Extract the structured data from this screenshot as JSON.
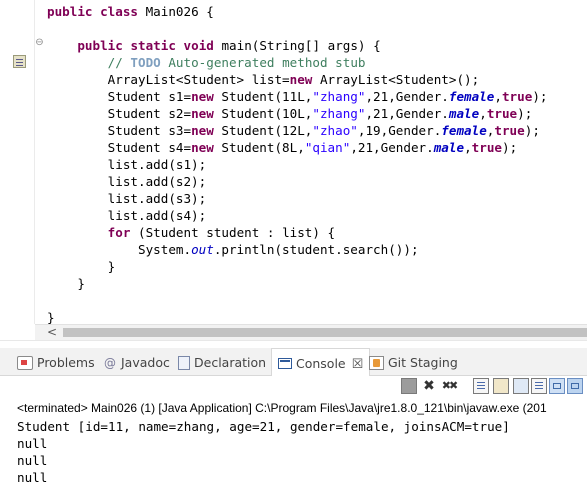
{
  "editor": {
    "lines": [
      {
        "parts": [
          {
            "t": "public",
            "c": "kw"
          },
          {
            "t": " "
          },
          {
            "t": "class",
            "c": "kw"
          },
          {
            "t": " Main026 {"
          }
        ]
      },
      {
        "parts": []
      },
      {
        "parts": [
          {
            "t": "    "
          },
          {
            "t": "public",
            "c": "kw"
          },
          {
            "t": " "
          },
          {
            "t": "static",
            "c": "kw"
          },
          {
            "t": " "
          },
          {
            "t": "void",
            "c": "kw"
          },
          {
            "t": " main(String[] args) {"
          }
        ]
      },
      {
        "parts": [
          {
            "t": "        "
          },
          {
            "t": "// ",
            "c": "cm"
          },
          {
            "t": "TODO",
            "c": "tg"
          },
          {
            "t": " Auto-generated method stub",
            "c": "cm"
          }
        ]
      },
      {
        "parts": [
          {
            "t": "        ArrayList<Student> list="
          },
          {
            "t": "new",
            "c": "kw"
          },
          {
            "t": " ArrayList<Student>();"
          }
        ]
      },
      {
        "parts": [
          {
            "t": "        Student s1="
          },
          {
            "t": "new",
            "c": "kw"
          },
          {
            "t": " Student(11L,"
          },
          {
            "t": "\"zhang\"",
            "c": "st"
          },
          {
            "t": ",21,Gender."
          },
          {
            "t": "female",
            "c": "fi"
          },
          {
            "t": ","
          },
          {
            "t": "true",
            "c": "kw"
          },
          {
            "t": ");"
          }
        ]
      },
      {
        "parts": [
          {
            "t": "        Student s2="
          },
          {
            "t": "new",
            "c": "kw"
          },
          {
            "t": " Student(10L,"
          },
          {
            "t": "\"zhang\"",
            "c": "st"
          },
          {
            "t": ",21,Gender."
          },
          {
            "t": "male",
            "c": "fi"
          },
          {
            "t": ","
          },
          {
            "t": "true",
            "c": "kw"
          },
          {
            "t": ");"
          }
        ]
      },
      {
        "parts": [
          {
            "t": "        Student s3="
          },
          {
            "t": "new",
            "c": "kw"
          },
          {
            "t": " Student(12L,"
          },
          {
            "t": "\"zhao\"",
            "c": "st"
          },
          {
            "t": ",19,Gender."
          },
          {
            "t": "female",
            "c": "fi"
          },
          {
            "t": ","
          },
          {
            "t": "true",
            "c": "kw"
          },
          {
            "t": ");"
          }
        ]
      },
      {
        "parts": [
          {
            "t": "        Student s4="
          },
          {
            "t": "new",
            "c": "kw"
          },
          {
            "t": " Student(8L,"
          },
          {
            "t": "\"qian\"",
            "c": "st"
          },
          {
            "t": ",21,Gender."
          },
          {
            "t": "male",
            "c": "fi"
          },
          {
            "t": ","
          },
          {
            "t": "true",
            "c": "kw"
          },
          {
            "t": ");"
          }
        ]
      },
      {
        "parts": [
          {
            "t": "        list.add(s1);"
          }
        ]
      },
      {
        "parts": [
          {
            "t": "        list.add(s2);"
          }
        ]
      },
      {
        "parts": [
          {
            "t": "        list.add(s3);"
          }
        ]
      },
      {
        "parts": [
          {
            "t": "        list.add(s4);"
          }
        ]
      },
      {
        "parts": [
          {
            "t": "        "
          },
          {
            "t": "for",
            "c": "kw"
          },
          {
            "t": " (Student student : list) {"
          }
        ]
      },
      {
        "parts": [
          {
            "t": "            System."
          },
          {
            "t": "out",
            "c": "sf"
          },
          {
            "t": ".println(student.search());"
          }
        ]
      },
      {
        "parts": [
          {
            "t": "        }"
          }
        ]
      },
      {
        "parts": [
          {
            "t": "    }"
          }
        ]
      },
      {
        "parts": []
      },
      {
        "parts": [
          {
            "t": "}"
          }
        ]
      }
    ],
    "fold_marker": "⊖",
    "scroll_left_arrow": "<"
  },
  "panel": {
    "tabs": [
      {
        "label": "Problems",
        "icon": "problems-icon"
      },
      {
        "label": "Javadoc",
        "icon": "javadoc-icon"
      },
      {
        "label": "Declaration",
        "icon": "declaration-icon"
      },
      {
        "label": "Console",
        "icon": "console-icon",
        "active": true
      },
      {
        "label": "Git Staging",
        "icon": "git-staging-icon"
      }
    ],
    "close_label": "☒",
    "status": "<terminated> Main026 (1) [Java Application] C:\\Program Files\\Java\\jre1.8.0_121\\bin\\javaw.exe (201",
    "output": [
      "Student [id=11, name=zhang, age=21, gender=female, joinsACM=true]",
      "null",
      "null",
      "null"
    ]
  },
  "colors": {
    "keyword": "#7f0055",
    "comment": "#3f7f5f",
    "string": "#2a00ff",
    "field": "#0000c0"
  }
}
